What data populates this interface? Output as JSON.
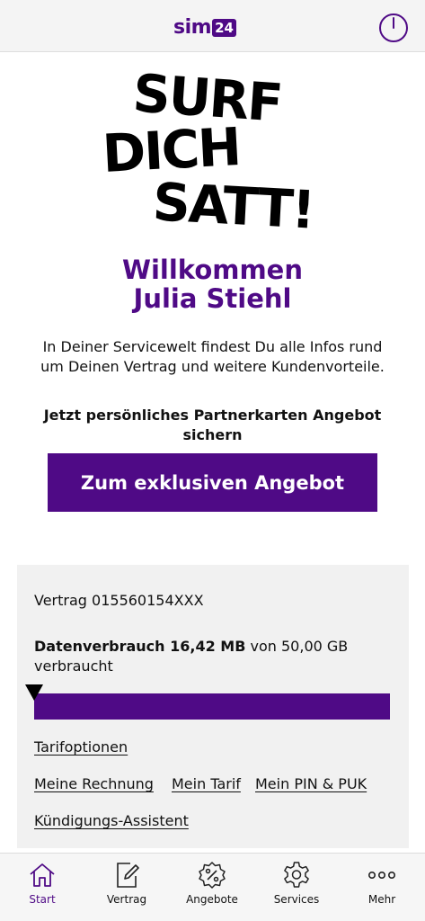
{
  "header": {
    "logo_text": "sim",
    "logo_box": "24"
  },
  "hero": {
    "line1": "SURF",
    "line2": "DICH",
    "line3": "SATT!"
  },
  "welcome": {
    "line1": "Willkommen",
    "line2": "Julia Stiehl"
  },
  "intro_text": "In Deiner Servicewelt findest Du alle Infos rund um Deinen Vertrag und weitere Kundenvorteile.",
  "partner_text": "Jetzt persönliches Partnerkarten Angebot sichern",
  "cta_label": "Zum exklusiven Angebot",
  "contract": {
    "label": "Vertrag 015560154XXX",
    "usage_bold": "Datenverbrauch 16,42 MB",
    "usage_rest": " von 50,00 GB verbraucht",
    "used_fraction": 0.0003,
    "links": {
      "tarifoptionen": "Tarifoptionen",
      "rechnung": "Meine Rechnung",
      "tarif": "Mein Tarif",
      "pin_puk": "Mein PIN & PUK",
      "kuendigung": "Kündigungs-Assistent"
    }
  },
  "nav": {
    "start": "Start",
    "vertrag": "Vertrag",
    "angebote": "Angebote",
    "services": "Services",
    "mehr": "Mehr"
  },
  "colors": {
    "brand": "#4f0a86",
    "card_bg": "#f1f1f1"
  }
}
